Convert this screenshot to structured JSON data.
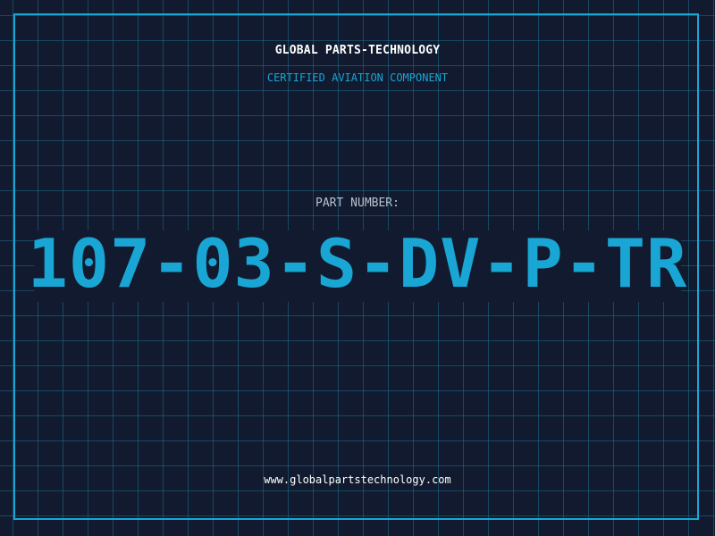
{
  "header": {
    "brand": "GLOBAL PARTS-TECHNOLOGY",
    "subtitle": "CERTIFIED AVIATION COMPONENT"
  },
  "part": {
    "label": "PART NUMBER:",
    "number": "107-03-S-DV-P-TR"
  },
  "footer": {
    "website": "www.globalpartstechnology.com"
  },
  "colors": {
    "background": "#111a2e",
    "accent": "#1aa6d4",
    "grid": "#1e6e8c",
    "text_primary": "#ffffff",
    "text_muted": "#b8c2d0"
  }
}
